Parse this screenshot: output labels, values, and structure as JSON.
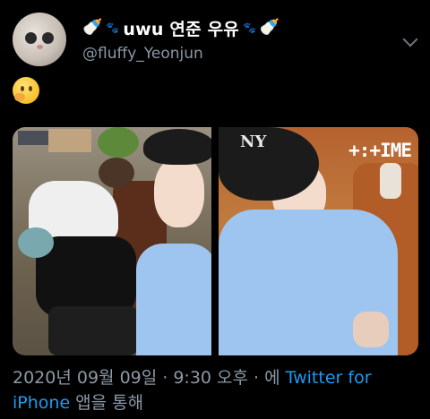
{
  "tweet": {
    "display_name": "uwu 연준 우유",
    "name_emojis": [
      "🍼",
      "🐾",
      "🐾",
      "🍼"
    ],
    "handle": "@fluffy_Yeonjun",
    "body_emoji": "🤔",
    "brand_watermark": "+:+IME",
    "cap_logo": "NY"
  },
  "meta": {
    "timestamp": "2020년 09월 09일 · 9:30 오후 · 에 ",
    "source": "Twitter for iPhone",
    "suffix": " 앱을 통해"
  },
  "icons": {
    "more": "chevron-down-icon"
  }
}
